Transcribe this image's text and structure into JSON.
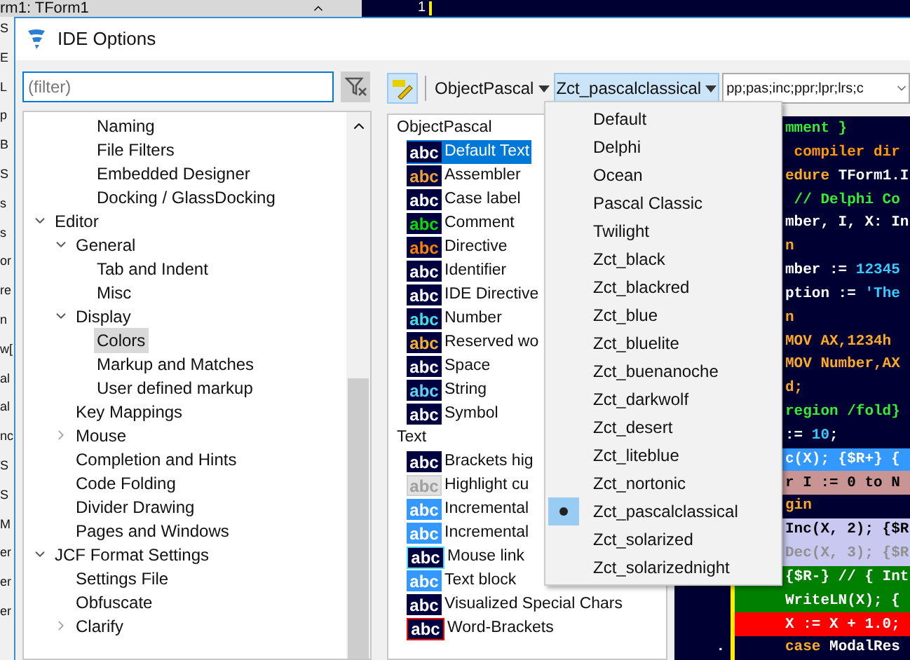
{
  "background_ide": {
    "form_caption": "rm1: TForm1",
    "gutter_number": "1",
    "edge_fragments": [
      "S",
      "E",
      "L",
      "p",
      "B",
      "S",
      "s",
      "s",
      "or",
      "re",
      "n",
      "w[",
      "al",
      "al",
      "nc",
      "S",
      "S",
      "M",
      "er",
      "er",
      "er"
    ]
  },
  "window": {
    "title": "IDE Options"
  },
  "filter": {
    "placeholder": "(filter)"
  },
  "tree": [
    {
      "children": [
        {
          "label": "Naming",
          "selected": false
        },
        {
          "label": "File Filters",
          "selected": false
        },
        {
          "label": "Embedded Designer",
          "selected": false
        },
        {
          "label": "Docking / GlassDocking",
          "selected": false
        }
      ]
    },
    {
      "label": "Editor",
      "selected": false,
      "expanded": true,
      "children": [
        {
          "label": "General",
          "selected": false,
          "expanded": true,
          "children": [
            {
              "label": "Tab and Indent",
              "selected": false
            },
            {
              "label": "Misc",
              "selected": false
            }
          ]
        },
        {
          "label": "Display",
          "selected": false,
          "expanded": true,
          "children": [
            {
              "label": "Colors",
              "selected": true
            },
            {
              "label": "Markup and Matches",
              "selected": false
            },
            {
              "label": "User defined markup",
              "selected": false
            }
          ]
        },
        {
          "label": "Key Mappings",
          "selected": false
        },
        {
          "label": "Mouse",
          "selected": false,
          "expanded": false
        },
        {
          "label": "Completion and Hints",
          "selected": false
        },
        {
          "label": "Code Folding",
          "selected": false
        },
        {
          "label": "Divider Drawing",
          "selected": false
        },
        {
          "label": "Pages and Windows",
          "selected": false
        }
      ]
    },
    {
      "label": "JCF Format Settings",
      "selected": false,
      "expanded": true,
      "children": [
        {
          "label": "Settings File",
          "selected": false
        },
        {
          "label": "Obfuscate",
          "selected": false
        },
        {
          "label": "Clarify",
          "selected": false,
          "expanded": false
        }
      ]
    }
  ],
  "toolbar": {
    "language": "ObjectPascal",
    "scheme": "Zct_pascalclassical",
    "extensions": "pp;pas;inc;ppr;lpr;lrs;c"
  },
  "elements": [
    {
      "group": "ObjectPascal",
      "items": [
        {
          "label": "Default Text",
          "sample": "abc",
          "selected": true,
          "kind": "navy",
          "color": "#ffffff"
        },
        {
          "label": "Assembler",
          "sample": "abc",
          "selected": false,
          "kind": "navy",
          "color": "#f0a030"
        },
        {
          "label": "Case label",
          "sample": "abc",
          "selected": false,
          "kind": "navy",
          "color": "#ffffff"
        },
        {
          "label": "Comment",
          "sample": "abc",
          "selected": false,
          "kind": "navy",
          "color": "#00e000"
        },
        {
          "label": "Directive",
          "sample": "abc",
          "selected": false,
          "kind": "navy",
          "color": "#ff8000"
        },
        {
          "label": "Identifier",
          "sample": "abc",
          "selected": false,
          "kind": "navy",
          "color": "#ffffff"
        },
        {
          "label": "IDE Directive",
          "sample": "abc",
          "selected": false,
          "kind": "navy",
          "color": "#ffffff"
        },
        {
          "label": "Number",
          "sample": "abc",
          "selected": false,
          "kind": "navy",
          "color": "#40e0e0"
        },
        {
          "label": "Reserved wo",
          "sample": "abc",
          "selected": false,
          "kind": "navy",
          "color": "#f0b030"
        },
        {
          "label": "Space",
          "sample": "abc",
          "selected": false,
          "kind": "navy",
          "color": "#ffffff"
        },
        {
          "label": "String",
          "sample": "abc",
          "selected": false,
          "kind": "navy",
          "color": "#60d0f0"
        },
        {
          "label": "Symbol",
          "sample": "abc",
          "selected": false,
          "kind": "navy",
          "color": "#ffffff"
        }
      ]
    },
    {
      "group": "Text",
      "items": [
        {
          "label": "Brackets hig",
          "sample": "abc",
          "selected": false,
          "kind": "navy",
          "color": "#ffffff"
        },
        {
          "label": "Highlight cu",
          "sample": "abc",
          "selected": false,
          "kind": "grey",
          "color": "#a0a0a0"
        },
        {
          "label": "Incremental",
          "sample": "abc",
          "selected": false,
          "kind": "blue",
          "color": "#ffffff"
        },
        {
          "label": "Incremental",
          "sample": "abc",
          "selected": false,
          "kind": "blue",
          "color": "#ffffff"
        },
        {
          "label": "Mouse link",
          "sample": "abc",
          "selected": false,
          "kind": "navy_cyan_frame",
          "color": "#ffffff"
        },
        {
          "label": "Text block",
          "sample": "abc",
          "selected": false,
          "kind": "blue",
          "color": "#ffffff"
        },
        {
          "label": "Visualized Special Chars",
          "sample": "abc",
          "selected": false,
          "kind": "navy",
          "color": "#ffffff"
        },
        {
          "label": "Word-Brackets",
          "sample": "abc",
          "selected": false,
          "kind": "navy_red_frame",
          "color": "#ffffff"
        }
      ]
    }
  ],
  "scheme_menu": [
    {
      "label": "Default",
      "selected": false
    },
    {
      "label": "Delphi",
      "selected": false
    },
    {
      "label": "Ocean",
      "selected": false
    },
    {
      "label": "Pascal Classic",
      "selected": false
    },
    {
      "label": "Twilight",
      "selected": false
    },
    {
      "label": "Zct_black",
      "selected": false
    },
    {
      "label": "Zct_blackred",
      "selected": false
    },
    {
      "label": "Zct_blue",
      "selected": false
    },
    {
      "label": "Zct_bluelite",
      "selected": false
    },
    {
      "label": "Zct_buenanoche",
      "selected": false
    },
    {
      "label": "Zct_darkwolf",
      "selected": false
    },
    {
      "label": "Zct_desert",
      "selected": false
    },
    {
      "label": "Zct_liteblue",
      "selected": false
    },
    {
      "label": "Zct_nortonic",
      "selected": false
    },
    {
      "label": "Zct_pascalclassical",
      "selected": true
    },
    {
      "label": "Zct_solarized",
      "selected": false
    },
    {
      "label": "Zct_solarizednight",
      "selected": false
    }
  ],
  "preview": {
    "lines": [
      {
        "segments": [
          {
            "text": "mment }",
            "color": "#33ee33"
          }
        ]
      },
      {
        "segments": [
          {
            "text": " compiler dir",
            "color": "#ff9900"
          }
        ]
      },
      {
        "segments": [
          {
            "text": "edure",
            "color": "#ffaa22"
          },
          {
            "text": " TForm1.I",
            "color": "#ffffff"
          }
        ]
      },
      {
        "segments": [
          {
            "text": " // Delphi Co",
            "color": "#33ee33"
          }
        ]
      },
      {
        "segments": [
          {
            "text": "mber, I, X: In",
            "color": "#ffffff"
          }
        ]
      },
      {
        "segments": [
          {
            "text": "n",
            "color": "#ffaa22"
          }
        ]
      },
      {
        "segments": [
          {
            "text": "mber := ",
            "color": "#ffffff"
          },
          {
            "text": "12345",
            "color": "#33ccff"
          }
        ]
      },
      {
        "segments": [
          {
            "text": "ption := ",
            "color": "#ffffff"
          },
          {
            "text": "'The",
            "color": "#33ccff"
          }
        ]
      },
      {
        "segments": [
          {
            "text": "n",
            "color": "#ffaa22"
          }
        ]
      },
      {
        "segments": [
          {
            "text": "MOV AX,1234h",
            "color": "#ffaa22"
          }
        ]
      },
      {
        "segments": [
          {
            "text": "MOV Number,AX",
            "color": "#ffaa22"
          }
        ]
      },
      {
        "segments": [
          {
            "text": "d;",
            "color": "#ffaa22"
          }
        ]
      },
      {
        "segments": [
          {
            "text": "region /fold}",
            "color": "#33ee33"
          }
        ]
      },
      {
        "segments": [
          {
            "text": ":= ",
            "color": "#ffffff"
          },
          {
            "text": "10",
            "color": "#33ccff"
          },
          {
            "text": ";",
            "color": "#ffffff"
          }
        ]
      },
      {
        "kind": "blue",
        "segments": [
          {
            "text": "c(X); {$R+} {",
            "color": "#ffffff"
          }
        ]
      },
      {
        "kind": "rose",
        "segments": [
          {
            "text": "r I := 0 to N",
            "color": "#000000"
          }
        ]
      },
      {
        "segments": [
          {
            "text": "gin",
            "color": "#ffaa22"
          }
        ]
      },
      {
        "kind": "lavender",
        "segments": [
          {
            "text": "Inc(X, 2); {$R",
            "color": "#000000"
          }
        ]
      },
      {
        "kind": "lavender",
        "segments": [
          {
            "text": "Dec(X, 3); {$R",
            "color": "#909090"
          }
        ]
      },
      {
        "kind": "green",
        "segments": [
          {
            "text": "{$R-} // { Int",
            "color": "#ffffff"
          }
        ]
      },
      {
        "kind": "green",
        "segments": [
          {
            "text": "WriteLN(X); {",
            "color": "#ffffff"
          }
        ]
      },
      {
        "kind": "red",
        "segments": [
          {
            "text": "X := X + 1.0;",
            "color": "#ffffff"
          }
        ]
      },
      {
        "gutter": ".",
        "segments": [
          {
            "text": "case",
            "color": "#ffaa22"
          },
          {
            "text": " ModalRes",
            "color": "#ffffff"
          }
        ]
      }
    ]
  }
}
